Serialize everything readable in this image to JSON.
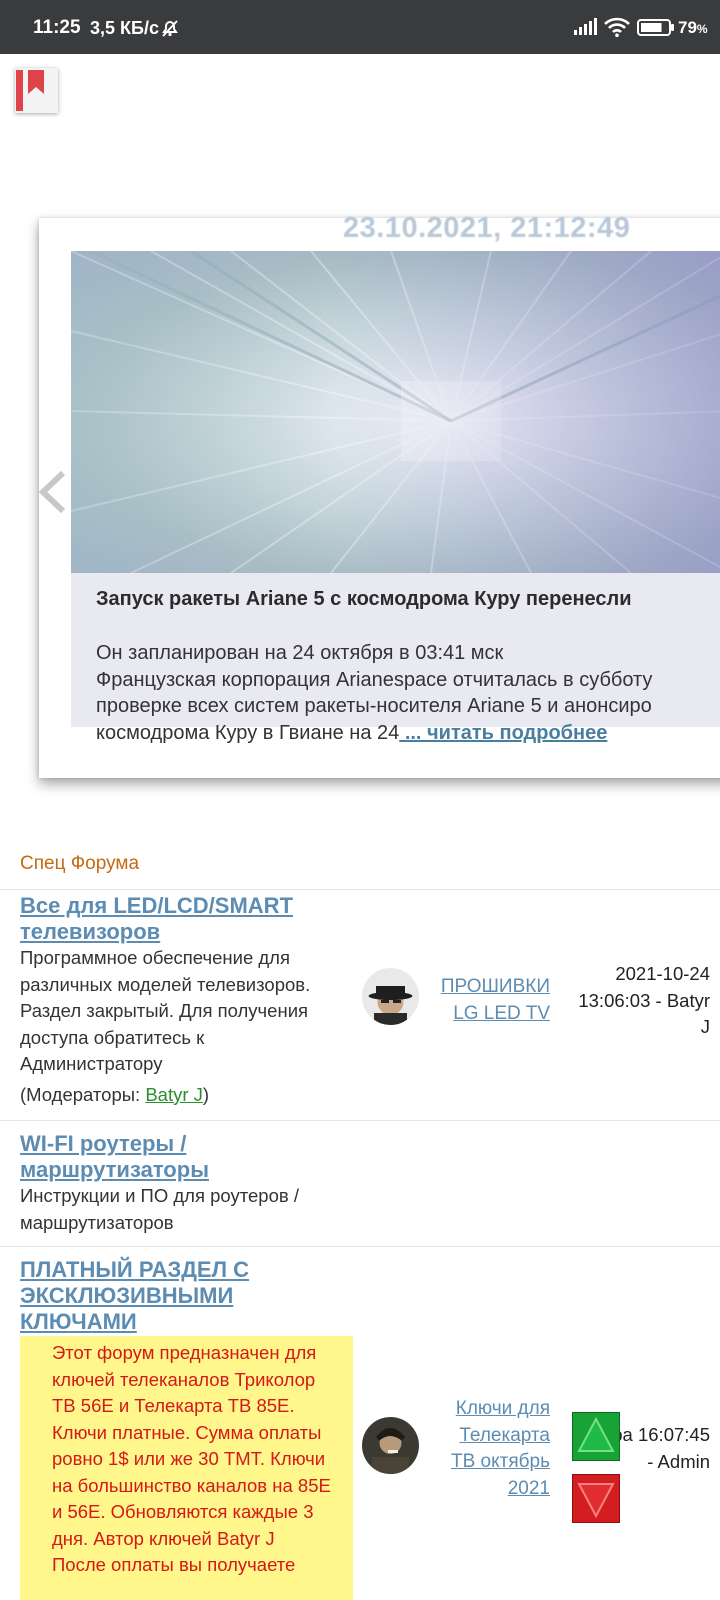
{
  "status_bar": {
    "time": "11:25",
    "speed": "3,5 КБ/с",
    "battery": "79",
    "battery_unit": "%",
    "battery_level": 0.79,
    "icons": [
      "silent-bell-icon",
      "signal-icon",
      "wifi-icon",
      "battery-icon"
    ]
  },
  "bookmark": {
    "icon": "bookmark-icon",
    "color": "#e0444b"
  },
  "slider": {
    "datetime": "23.10.2021, 21:12:49",
    "title": "Запуск ракеты Ariane 5 с космодрома Куру перенесли",
    "lines": [
      "Он запланирован на 24 октября в 03:41 мск",
      "Французская корпорация Arianespace отчиталась в субботу",
      "проверке всех систем ракеты-носителя Ariane 5 и анонсиро",
      "космодрома Куру в Гвиане на 24"
    ],
    "read_more": " ... читать подробнее"
  },
  "forum": {
    "section_title": "Спец Форума",
    "items": [
      {
        "title_line1": "Все для LED/LCD/SMART",
        "title_line2": "телевизоров",
        "desc": [
          "Программное обеспечение для",
          "различных моделей телевизоров.",
          "Раздел закрытый. Для получения",
          "доступа обратитесь к",
          "Администратору"
        ],
        "mods_prefix": "(Модераторы: ",
        "mod_name": "Batyr J",
        "mods_suffix": ")",
        "last_topic": [
          "ПРОШИВКИ",
          "LG LED TV"
        ],
        "last_post": [
          "2021-10-24",
          "13:06:03 - Batyr",
          "J"
        ]
      },
      {
        "title_line1": "WI-FI роутеры /",
        "title_line2": "маршрутизаторы",
        "desc": [
          "Инструкции и ПО для роутеров /",
          "маршрутизаторов"
        ]
      },
      {
        "title": [
          "ПЛАТНЫЙ РАЗДЕЛ С",
          "ЭКСКЛЮЗИВНЫМИ",
          "КЛЮЧАМИ"
        ],
        "notice": [
          "Этот форум предназначен для",
          "ключей телеканалов Триколор",
          "ТВ 56E и Телекарта ТВ 85E.",
          "Ключи платные. Сумма оплаты",
          "ровно 1$ или же 30 ТМТ. Ключи",
          "на большинство каналов на 85E",
          "и 56E. Обновляются каждые 3",
          "дня. Автор ключей Batyr J",
          "После оплаты вы получаете"
        ],
        "last_topic": [
          "Ключи для",
          "Телекарта",
          "ТВ октябрь",
          "2021"
        ],
        "last_post": [
          "Вчера 16:07:45",
          "- Admin"
        ]
      }
    ]
  }
}
